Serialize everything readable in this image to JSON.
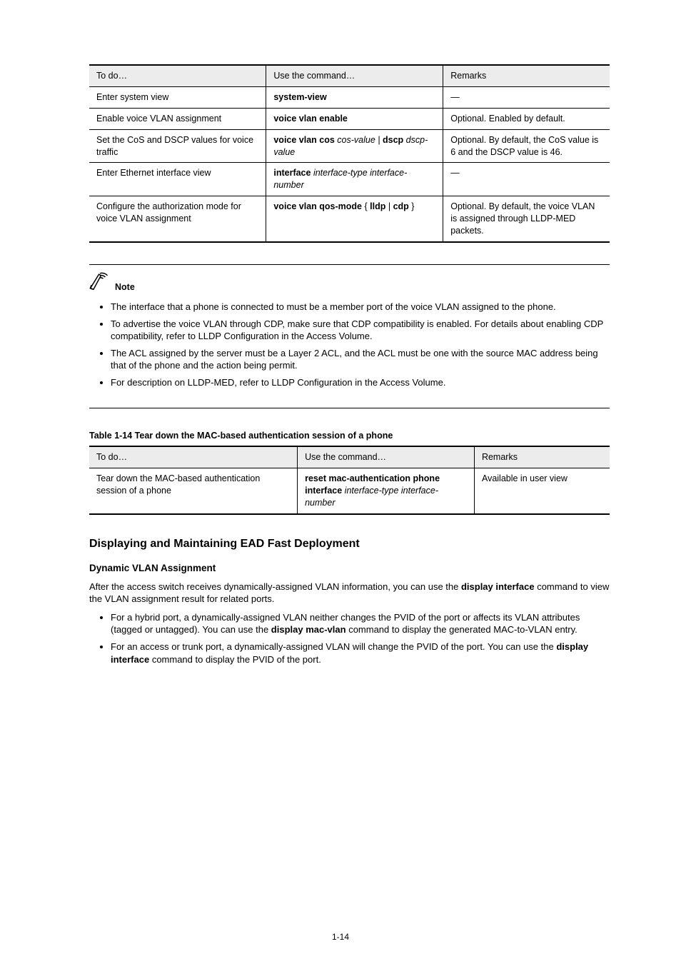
{
  "table1": {
    "head": [
      "To do…",
      "Use the command…",
      "Remarks"
    ],
    "rows": [
      {
        "c1": "Enter system view",
        "c2_bold": "system-view",
        "c2_rest": "",
        "c3": "—"
      },
      {
        "c1a": "Enable ",
        "c1b": "voice",
        "c1c": " VLAN assignment",
        "c2_bold": "voice vlan enable",
        "c2_rest": "",
        "c3": "Optional. Enabled by default."
      },
      {
        "c1a": "Set the CoS and DSCP values for voice traffic",
        "c1b": "",
        "c1c": "",
        "c2_bold": "voice vlan cos",
        "c2_rest": " cos-value | ",
        "c2_b2": "dscp",
        "c2_rest2": " dscp-value",
        "c3": "Optional. By default, the CoS value is 6 and the DSCP value is 46."
      },
      {
        "c1a": "Enter Ethernet interface view",
        "c1b": "",
        "c1c": "",
        "c2_bold": "interface",
        "c2_rest": " interface-type interface-number",
        "c3": "—"
      },
      {
        "c1a": "Configure the authorization mode for voice VLAN assignment",
        "c1b": "",
        "c1c": "",
        "c2_bold": "voice vlan qos-mode",
        "c2_rest": " { ",
        "c2_b2": "lldp",
        "c2_rest2": " | ",
        "c2_b3": "cdp",
        "c2_rest3": " }",
        "c3": "Optional. By default, the voice VLAN is assigned through LLDP-MED packets."
      }
    ]
  },
  "note": {
    "label": "Note",
    "items": [
      "The interface that a phone is connected to must be a member port of the voice VLAN assigned to the phone.",
      "To advertise the voice VLAN through CDP, make sure that CDP compatibility is enabled. For details about enabling CDP compatibility, refer to LLDP Configuration in the Access Volume.",
      "The ACL assigned by the server must be a Layer 2 ACL, and the ACL must be one with the source MAC address being that of the phone and the action being permit.",
      "For description on LLDP-MED, refer to LLDP Configuration in the Access Volume."
    ]
  },
  "table2": {
    "caption": "Table 1-14 Tear down the MAC-based authentication session of a phone",
    "head": [
      "To do…",
      "Use the command…",
      "Remarks"
    ],
    "row": {
      "c1": "Tear down the MAC-based authentication session of a phone",
      "c2_bold": "reset mac-authentication phone interface",
      "c2_rest": " interface-type interface-number",
      "c3": "Available in user view"
    }
  },
  "headings": {
    "h2": "Displaying and Maintaining EAD Fast Deployment",
    "h3": "Dynamic VLAN Assignment"
  },
  "para": {
    "p1_a": "After the access switch receives dynamically-assigned VLAN information, you can use the ",
    "p1_b": "display interface",
    "p1_c": " command to view the VLAN assignment result for related ports.",
    "p2_a": "For a hybrid port, a dynamically-assigned VLAN neither changes the PVID of the port or affects its VLAN attributes (tagged or untagged). You can use the ",
    "p2_b": "display mac-vlan",
    "p2_c": " command to display the generated MAC-to-VLAN entry.",
    "p3_a": "For an access or trunk port, a dynamically-assigned VLAN will change the PVID of the port. You can use the ",
    "p3_b": "display interface",
    "p3_c": " command to display the PVID of the port."
  },
  "assign_items": [
    {
      "a": "For a hybrid port, a dynamically-assigned VLAN neither changes the PVID of the port or affects its VLAN attributes (tagged or untagged). You can use the ",
      "b": "display mac-vlan",
      "c": " command to display the generated MAC-to-VLAN entry."
    },
    {
      "a": "For an access or trunk port, a dynamically-assigned VLAN will change the PVID of the port. You can use the ",
      "b": "display interface",
      "c": " command to display the PVID of the port."
    }
  ],
  "pagenum": "1-14"
}
